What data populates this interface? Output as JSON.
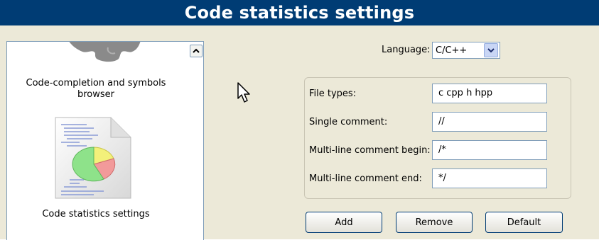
{
  "title": "Code statistics settings",
  "sidebar": {
    "items": [
      {
        "label": "Code-completion and symbols browser",
        "icon": "puzzle-icon"
      },
      {
        "label": "Code statistics settings",
        "icon": "code-statistics-icon"
      }
    ]
  },
  "language": {
    "label": "Language:",
    "value": "C/C++"
  },
  "fields": [
    {
      "label": "File types:",
      "value": "c cpp h hpp"
    },
    {
      "label": "Single comment:",
      "value": "//"
    },
    {
      "label": "Multi-line comment begin:",
      "value": "/*"
    },
    {
      "label": "Multi-line comment end:",
      "value": "*/"
    }
  ],
  "buttons": {
    "add": "Add",
    "remove": "Remove",
    "default": "Default"
  },
  "colors": {
    "title_bar": "#003c74",
    "panel": "#ece9d8"
  }
}
